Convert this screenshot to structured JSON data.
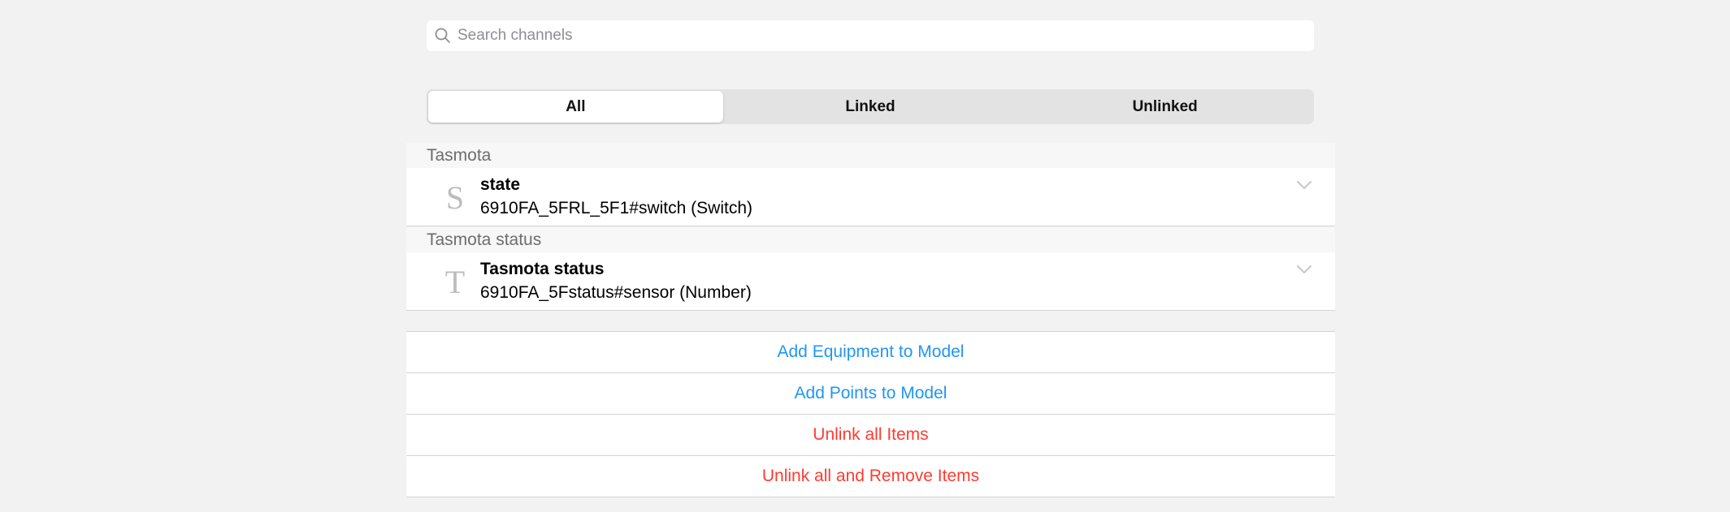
{
  "search": {
    "placeholder": "Search channels",
    "icon": "search-icon"
  },
  "filter_tabs": [
    {
      "label": "All",
      "selected": true
    },
    {
      "label": "Linked",
      "selected": false
    },
    {
      "label": "Unlinked",
      "selected": false
    }
  ],
  "groups": [
    {
      "header": "Tasmota",
      "items": [
        {
          "letter": "S",
          "title": "state",
          "subtitle": "6910FA_5FRL_5F1#switch (Switch)",
          "icon": "chevron-down-icon"
        }
      ]
    },
    {
      "header": "Tasmota status",
      "items": [
        {
          "letter": "T",
          "title": "Tasmota status",
          "subtitle": "6910FA_5Fstatus#sensor (Number)",
          "icon": "chevron-down-icon"
        }
      ]
    }
  ],
  "actions": [
    {
      "label": "Add Equipment to Model",
      "color": "#2196f3"
    },
    {
      "label": "Add Points to Model",
      "color": "#2196f3"
    },
    {
      "label": "Unlink all Items",
      "color": "#ff3b30"
    },
    {
      "label": "Unlink all and Remove Items",
      "color": "#ff3b30"
    }
  ]
}
